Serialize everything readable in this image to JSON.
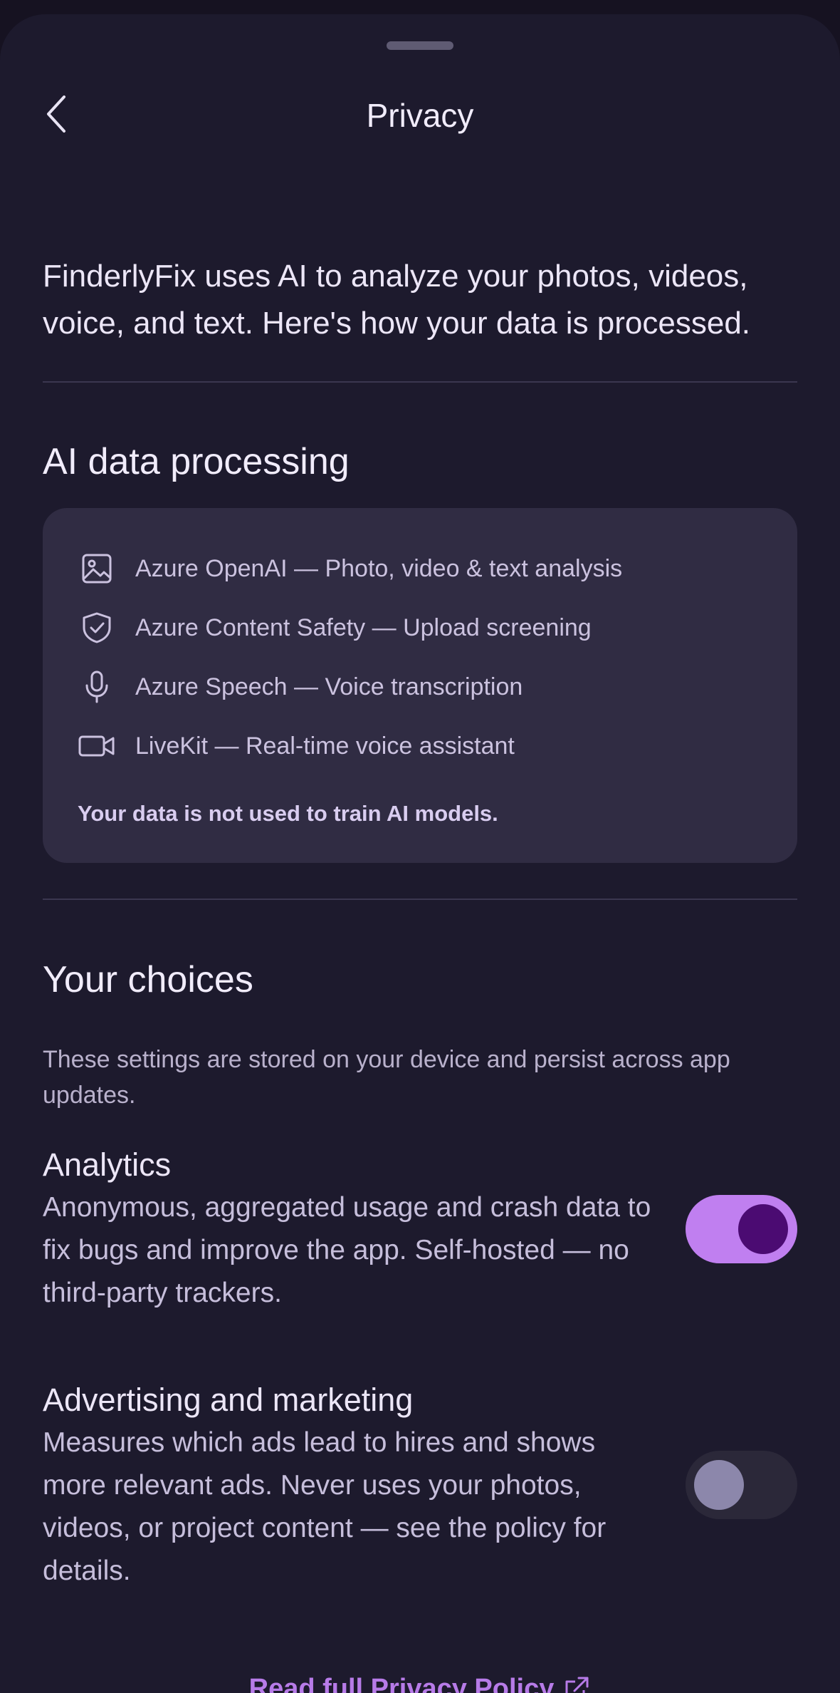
{
  "header": {
    "title": "Privacy"
  },
  "intro": "FinderlyFix uses AI to analyze your photos, videos, voice, and text. Here's how your data is processed.",
  "ai_processing": {
    "title": "AI data processing",
    "services": [
      {
        "icon": "image-icon",
        "text": "Azure OpenAI — Photo, video & text analysis"
      },
      {
        "icon": "shield-check-icon",
        "text": "Azure Content Safety — Upload screening"
      },
      {
        "icon": "microphone-icon",
        "text": "Azure Speech — Voice transcription"
      },
      {
        "icon": "video-camera-icon",
        "text": "LiveKit — Real-time voice assistant"
      }
    ],
    "note": "Your data is not used to train AI models."
  },
  "choices": {
    "title": "Your choices",
    "subtitle": "These settings are stored on your device and persist across app updates.",
    "options": [
      {
        "title": "Analytics",
        "description": "Anonymous, aggregated usage and crash data to fix bugs and improve the app. Self-hosted — no third-party trackers.",
        "enabled": true
      },
      {
        "title": "Advertising and marketing",
        "description": "Measures which ads lead to hires and shows more relevant ads. Never uses your photos, videos, or project content — see the policy for details.",
        "enabled": false
      }
    ]
  },
  "policy_link": {
    "label": "Read full Privacy Policy",
    "icon": "external-link-icon"
  },
  "colors": {
    "background": "#1d1a2d",
    "card": "#302c43",
    "accent": "#c07ff0",
    "toggle_knob_on": "#4b0b72"
  }
}
